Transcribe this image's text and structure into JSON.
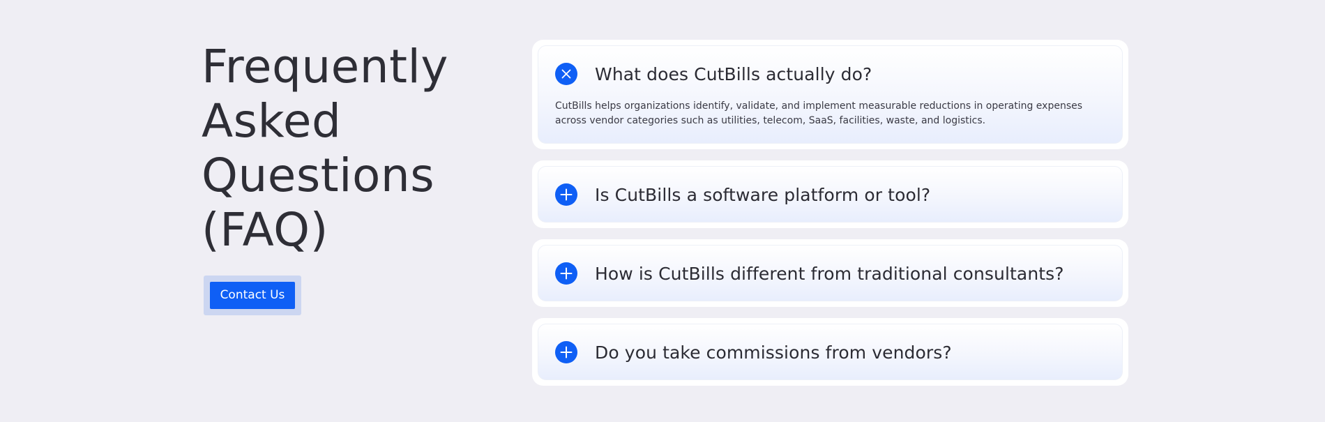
{
  "heading": "Frequently Asked Questions (FAQ)",
  "cta": {
    "label": "Contact Us"
  },
  "faq": [
    {
      "question": "What does CutBills actually do?",
      "answer": "CutBills helps organizations identify, validate, and implement measurable reductions in operating expenses across vendor categories such as utilities, telecom, SaaS, facilities, waste, and logistics.",
      "expanded": true,
      "icon": "close-icon"
    },
    {
      "question": "Is CutBills a software platform or tool?",
      "expanded": false,
      "icon": "plus-icon"
    },
    {
      "question": "How is CutBills different from traditional consultants?",
      "expanded": false,
      "icon": "plus-icon"
    },
    {
      "question": "Do you take commissions from vendors?",
      "expanded": false,
      "icon": "plus-icon"
    }
  ],
  "colors": {
    "accent": "#0f5ff5",
    "background": "#efeef4",
    "cta_halo": "#ccd6f1",
    "heading_text": "#2e2e36"
  }
}
